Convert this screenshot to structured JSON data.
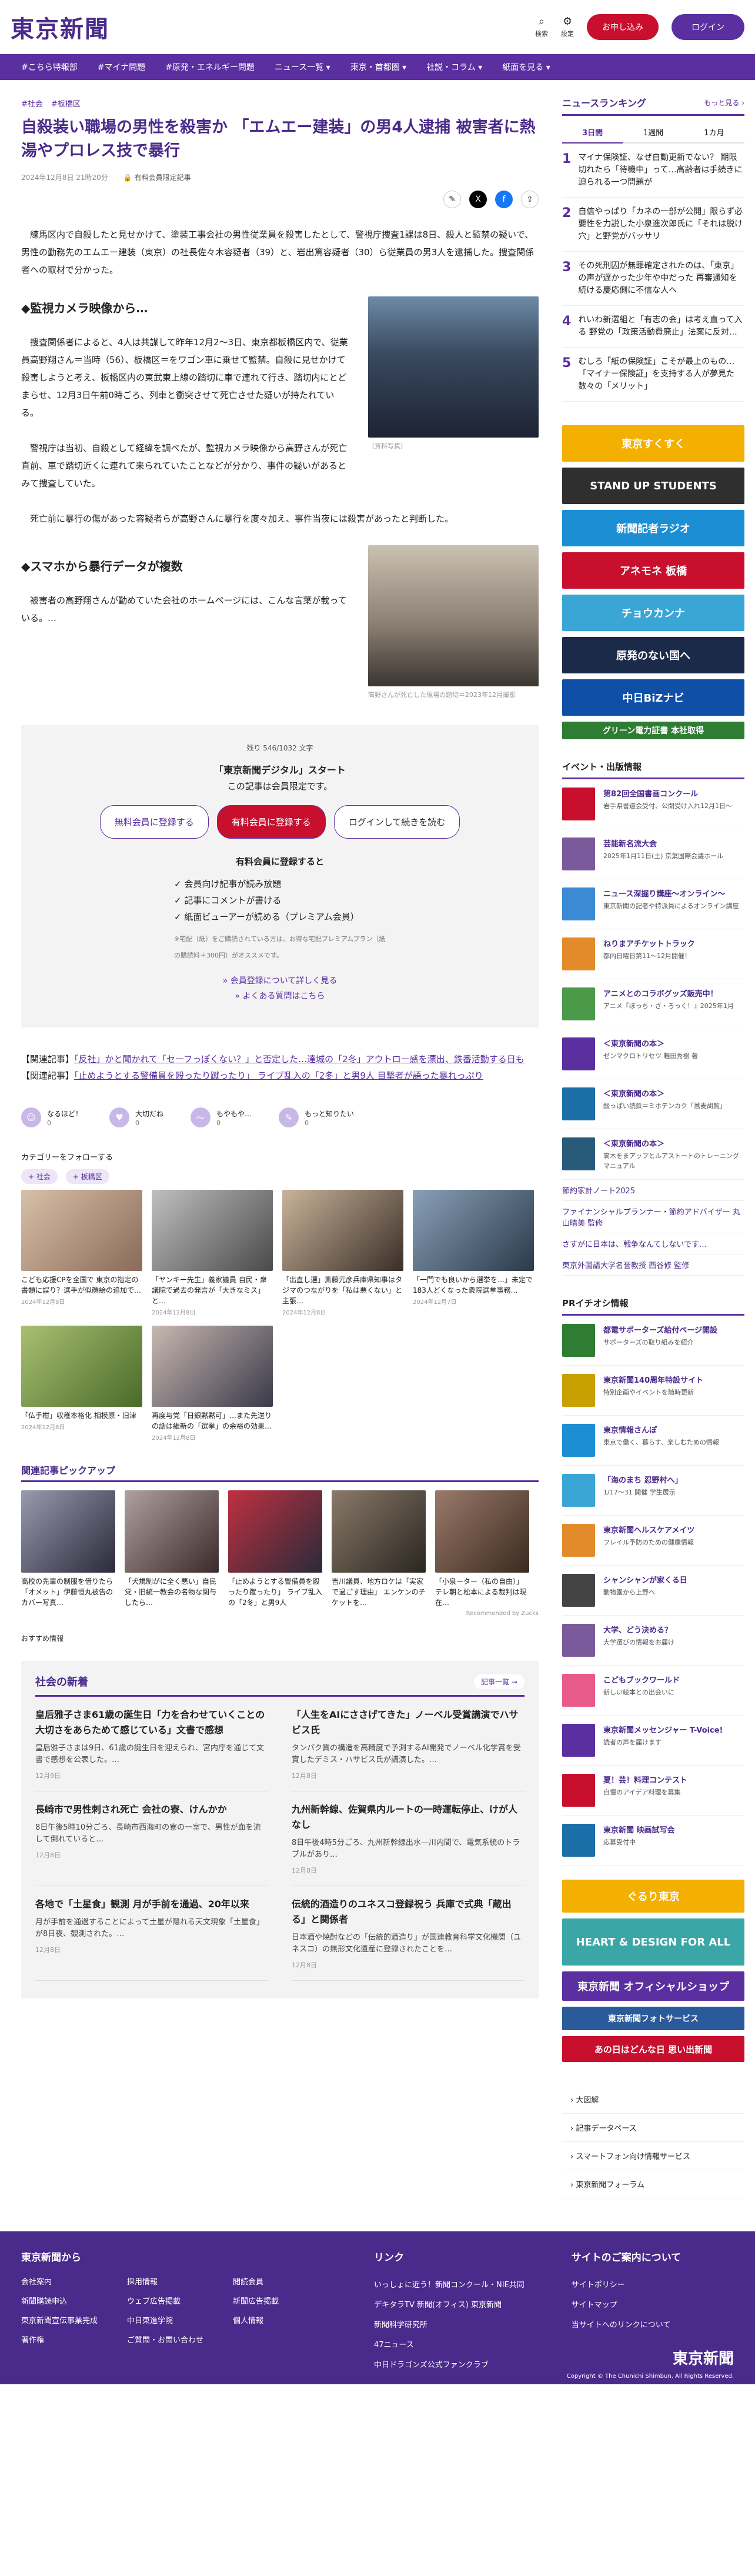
{
  "header": {
    "logo": "東京新聞",
    "search_label": "検索",
    "settings_label": "設定",
    "signup": "お申し込み",
    "login": "ログイン"
  },
  "nav": [
    "#こちら特報部",
    "#マイナ問題",
    "#原発・エネルギー問題",
    "ニュース一覧 ▾",
    "東京・首都圏 ▾",
    "社説・コラム ▾",
    "紙面を見る ▾"
  ],
  "article": {
    "crumbs": [
      "#社会",
      "#板橋区"
    ],
    "title": "自殺装い職場の男性を殺害か 「エムエー建装」の男4人逮捕 被害者に熱湯やプロレス技で暴行",
    "date": "2024年12月8日 21時20分",
    "member": "有料会員限定記事",
    "p1": "練馬区内で自殺したと見せかけて、塗装工事会社の男性従業員を殺害したとして、警視庁捜査1課は8日、殺人と監禁の疑いで、男性の勤務先のエムエー建装（東京）の社長佐々木容疑者（39）と、岩出篤容疑者（30）ら従業員の男3人を逮捕した。捜査関係者への取材で分かった。",
    "s1": "◆監視カメラ映像から…",
    "p2": "捜査関係者によると、4人は共謀して昨年12月2～3日、東京都板橋区内で、従業員高野翔さん＝当時（56）、板橋区＝をワゴン車に乗せて監禁。自殺に見せかけて殺害しようと考え、板橋区内の東武東上線の踏切に車で連れて行き、踏切内にとどまらせ、12月3日午前0時ごろ、列車と衝突させて死亡させた疑いが持たれている。",
    "p3": "警視庁は当初、自殺として経緯を調べたが、監視カメラ映像から高野さんが死亡直前、車で踏切近くに連れて来られていたことなどが分かり、事件の疑いがあるとみて捜査していた。",
    "p4": "死亡前に暴行の傷があった容疑者らが高野さんに暴行を度々加え、事件当夜には殺害があったと判断した。",
    "cap1": "（資料写真）",
    "s2": "◆スマホから暴行データが複数",
    "p5": "被害者の高野翔さんが勤めていた会社のホームページには、こんな言葉が載っている。…",
    "cap2": "高野さんが死亡した現場の踏切＝2023年12月撮影"
  },
  "paywall": {
    "remain": "残り 546/1032 文字",
    "headline": "「東京新聞デジタル」スタート",
    "sub": "この記事は会員限定です。",
    "btn_free": "無料会員に登録する",
    "btn_paid": "有料会員に登録する",
    "btn_login": "ログインして続きを読む",
    "benefit_h": "有料会員に登録すると",
    "benefits": [
      "✓ 会員向け記事が読み放題",
      "✓ 記事にコメントが書ける",
      "✓ 紙面ビューアーが読める（プレミアム会員）"
    ],
    "note": "※宅配（紙）をご購読されている方は、お得な宅配プレミアムプラン（紙の購読料＋300円）がオススメです。",
    "link1": "» 会員登録について詳しく見る",
    "link2": "» よくある質問はこちら"
  },
  "related": [
    {
      "label": "【関連記事】",
      "text": "「反社」かと聞かれて「セーフっぽくない？」と否定した…達城の「2冬」アウトロー感を漂出、鉄番活動する日も"
    },
    {
      "label": "【関連記事】",
      "text": "「止めようとする警備員を殴ったり蹴ったり」 ライブ乱入の「2冬」と男9人 目撃者が語った暴れっぷり"
    }
  ],
  "reactions": [
    {
      "icon": "☺",
      "label": "なるほど！",
      "count": "0"
    },
    {
      "icon": "♥",
      "label": "大切だね",
      "count": "0"
    },
    {
      "icon": "～",
      "label": "もやもや…",
      "count": "0"
    },
    {
      "icon": "✎",
      "label": "もっと知りたい",
      "count": "0"
    }
  ],
  "category": {
    "heading": "カテゴリーをフォローする",
    "chips": [
      "+ 社会",
      "+ 板橋区"
    ]
  },
  "thumbs": [
    {
      "title": "こども応援CPを全国で 東京の指定の書類に誤り？選手が似顔絵の追加で…",
      "date": "2024年12月8日"
    },
    {
      "title": "「ヤンキー先生」義家議員 自民・衆議院で過去の発言が「大きなミス」と…",
      "date": "2024年12月8日"
    },
    {
      "title": "「出直し選」斎藤元彦兵庫県知事はタジマのつながりを「私は悪くない」と主張…",
      "date": "2024年12月8日"
    },
    {
      "title": "「一門でも良いから選挙を…」未定で183人どくなった衆院選挙事務…",
      "date": "2024年12月7日"
    },
    {
      "title": "「仏手柑」収穫本格化 相模原・旧津",
      "date": "2024年12月8日"
    },
    {
      "title": "再度与党「日銀黙黙可」…また先送りの話は維新の「選挙」の余裕の効果…",
      "date": "2024年12月8日"
    }
  ],
  "picks": {
    "heading": "関連記事ピックアップ",
    "items": [
      "高校の先輩の制服を借りたら「オメット」伊藤恒丸被告のカバー写真…",
      "「犬規制がに全く悪い」自民党・旧統一教会の名物な関与したら…",
      "「止めようとする警備員を殴ったり蹴ったり」 ライブ乱入の「2冬」と男9人",
      "吉川議員、地方ロケは「実家で過ごす理由」 エンケンのチケットを…",
      "「小泉ーター（私の自由）」テレ朝と松本による裁判は現在…"
    ],
    "recommend": "Recommended by Zucks"
  },
  "osusume": "おすすめ情報",
  "social": {
    "heading": "社会の新着",
    "more": "記事一覧 →",
    "items": [
      {
        "h": "皇后雅子さま61歳の誕生日「力を合わせていくことの大切さをあらためて感じている」文書で感想",
        "p": "皇后雅子さまは9日、61歳の誕生日を迎えられ、宮内庁を通じて文書で感想を公表した。…",
        "d": "12月9日"
      },
      {
        "h": "「人生をAIにささげてきた」ノーベル受賞講演でハサビス氏",
        "p": "タンパク質の構造を高精度で予測するAI開発でノーベル化学賞を受賞したデミス・ハサビス氏が講演した。…",
        "d": "12月8日"
      },
      {
        "h": "長崎市で男性刺され死亡 会社の寮、けんかか",
        "p": "8日午後5時10分ごろ、長崎市西海町の寮の一室で、男性が血を流して倒れていると…",
        "d": "12月8日"
      },
      {
        "h": "九州新幹線、佐賀県内ルートの一時運転停止、けが人なし",
        "p": "8日午後4時5分ごろ、九州新幹線出水―川内間で、電気系統のトラブルがあり…",
        "d": "12月8日"
      },
      {
        "h": "各地で「土星食」観測 月が手前を通過、20年以来",
        "p": "月が手前を通過することによって土星が隠れる天文現象「土星食」が8日夜、観測された。…",
        "d": "12月8日"
      },
      {
        "h": "伝統的酒造りのユネスコ登録祝う 兵庫で式典「蔵出る」と関係者",
        "p": "日本酒や焼酎などの「伝統的酒造り」が国連教育科学文化機関（ユネスコ）の無形文化遺産に登録されたことを…",
        "d": "12月8日"
      }
    ]
  },
  "ranking": {
    "heading": "ニュースランキング",
    "more": "もっと見る ›",
    "tabs": [
      "3日間",
      "1週間",
      "1カ月"
    ],
    "items": [
      "マイナ保険証、なぜ自動更新でない？ 期限切れたら「待機中」って…高齢者は手続きに迫られる一つ問題が",
      "自信やっぱり「カネの一部が公開」限らず必要性を力説した小泉進次郎氏に「それは脱け穴」と野党がバッサリ",
      "その死刑囚が無罪確定されたのは、「東京」の声が遅かった少年や中だった 再審通知を続ける慶応側に不信な人へ",
      "れいわ新選組と「有志の会」は考え直って入る 野党の「政策活動費廃止」法案に反対…",
      "むしろ「紙の保険証」こそが最上のもの… 「マイナー保険証」を支持する人が夢見た数々の「メリット」"
    ]
  },
  "banners": [
    {
      "label": "東京すくすく",
      "color": "#f4b000"
    },
    {
      "label": "STAND UP STUDENTS",
      "color": "#2f2f2f"
    },
    {
      "label": "新聞記者ラジオ",
      "color": "#1c8fd4"
    },
    {
      "label": "アネモネ 板橋",
      "color": "#c8102e"
    },
    {
      "label": "チョウカンナ",
      "color": "#3aa6d6"
    },
    {
      "label": "原発のない国へ",
      "color": "#1c2a4a"
    },
    {
      "label": "中日BiZナビ",
      "color": "#0f4fa8"
    },
    {
      "label": "グリーン電力証書 本社取得",
      "color": "#2e7d32"
    }
  ],
  "events": {
    "heading": "イベント・出版情報",
    "items": [
      {
        "t": "第82回全国書画コンクール",
        "s": "岩手県書道会受付、公開受け入れ12月1日～",
        "c": "#c8102e"
      },
      {
        "t": "芸能新名流大会",
        "s": "2025年1月11日(土) 京葉国際会議ホール",
        "c": "#7a5a9a"
      },
      {
        "t": "ニュース深掘り講座～オンライン～",
        "s": "東京新聞の記者や特派員によるオンライン講座",
        "c": "#3a8ad4"
      },
      {
        "t": "ねりまアチケットトラック",
        "s": "都内日曜日第11～12月開催！",
        "c": "#e38b2a"
      },
      {
        "t": "アニメとのコラボグッズ販売中！",
        "s": "アニメ『ぼっち・ざ・ろっく！』2025年1月",
        "c": "#4a9a4a"
      },
      {
        "t": "＜東京新聞の本＞",
        "s": "ゼンマクロトリセツ 軽田秀樹 著",
        "c": "#5b2fa0"
      },
      {
        "t": "＜東京新聞の本＞",
        "s": "酸っぱい読鉄＝ミホテンカク「蕎麦胡覧」",
        "c": "#1a6fa8"
      },
      {
        "t": "＜東京新聞の本＞",
        "s": "高木をまアップとルアストートのトレーニングマニュアル",
        "c": "#2a5a7a"
      }
    ],
    "links": [
      "節約家計ノート2025",
      "ファイナンシャルプランナー・節約アドバイザー 丸山晴美 監修",
      "さすがに日本は、戦争なんてしないです…",
      "東京外国語大学名誉教授 西谷修 監修"
    ]
  },
  "pr": {
    "heading": "PRイチオシ情報",
    "items": [
      {
        "t": "都電サポーターズ給付ページ開設",
        "s": "サポーターズの取り組みを紹介",
        "c": "#2e7d32"
      },
      {
        "t": "東京新聞140周年特設サイト",
        "s": "特別企画やイベントを随時更新",
        "c": "#c8a000"
      },
      {
        "t": "東京情報さんぽ",
        "s": "東京で働く、暮らす、楽しむための情報",
        "c": "#1c8fd4"
      },
      {
        "t": "「海のまち 忍野村へ」",
        "s": "1/17～31 開催 学生展示",
        "c": "#3aa6d6"
      },
      {
        "t": "東京新聞ヘルスケアメイツ",
        "s": "フレイル予防のための健康情報",
        "c": "#e38b2a"
      },
      {
        "t": "シャンシャンが家くる日",
        "s": "動物園から上野へ",
        "c": "#444"
      },
      {
        "t": "大学、どう決める？",
        "s": "大学選びの情報をお届け",
        "c": "#7a5a9a"
      },
      {
        "t": "こどもブックワールド",
        "s": "新しい絵本との出会いに",
        "c": "#e85a8a"
      },
      {
        "t": "東京新聞メッセンジャー T-Voice!",
        "s": "読者の声を届けます",
        "c": "#5b2fa0"
      },
      {
        "t": "夏！芸！料理コンテスト",
        "s": "自慢のアイデア料理を募集",
        "c": "#c8102e"
      },
      {
        "t": "東京新聞 映画試写会",
        "s": "応募受付中",
        "c": "#1a6fa8"
      }
    ],
    "banners": [
      {
        "label": "ぐるり東京",
        "color": "#f4b000"
      },
      {
        "label": "HEART & DESIGN FOR ALL",
        "color": "#3aa6a6"
      },
      {
        "label": "東京新聞 オフィシャルショップ",
        "color": "#5b2fa0"
      },
      {
        "label": "東京新聞フォトサービス",
        "color": "#2a5a9a"
      },
      {
        "label": "あの日はどんな日 思い出新聞",
        "color": "#c8102e"
      }
    ]
  },
  "side_nav": [
    "› 大図解",
    "› 記事データベース",
    "› スマートフォン向け情報サービス",
    "› 東京新聞フォーラム"
  ],
  "footer": {
    "c1": {
      "h": "東京新聞から",
      "items": [
        "会社案内",
        "採用情報",
        "閲読会員",
        "新聞購読申込",
        "ウェブ広告掲載",
        "新聞広告掲載",
        "東京新聞宣伝事業完成",
        "中日東進学院",
        "個人情報",
        "著作権",
        "ご質問・お問い合わせ",
        ""
      ]
    },
    "c2": {
      "h": "リンク",
      "items": [
        "いっしょに近う！新聞コンクール・NIE共同",
        "デキタラTV 新聞(オフィス) 東京新聞",
        "新聞科学研究所",
        "47ニュース",
        "中日ドラゴンズ公式ファンクラブ"
      ]
    },
    "c3": {
      "h": "サイトのご案内について",
      "items": [
        "サイトポリシー",
        "サイトマップ",
        "当サイトへのリンクについて"
      ]
    },
    "logo": "東京新聞",
    "copy": "Copyright © The Chunichi Shimbun, All Rights Reserved."
  }
}
